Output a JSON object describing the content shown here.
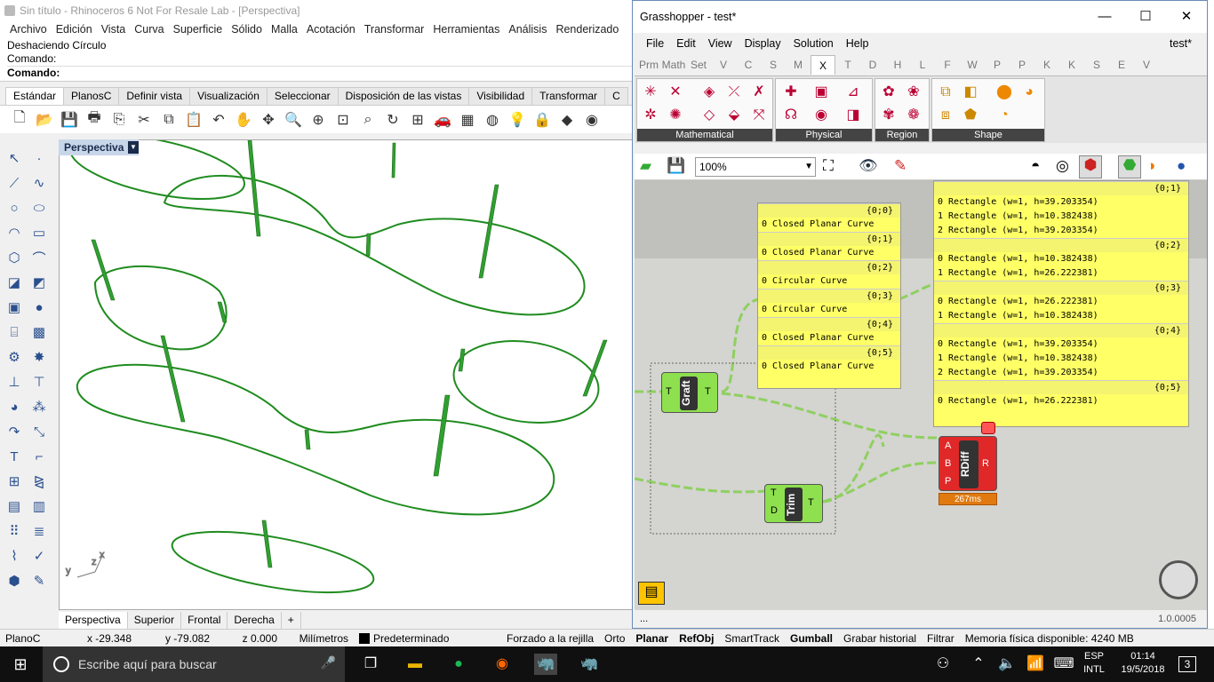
{
  "rhino": {
    "title": "Sin título - Rhinoceros 6 Not For Resale Lab - [Perspectiva]",
    "menu": [
      "Archivo",
      "Edición",
      "Vista",
      "Curva",
      "Superficie",
      "Sólido",
      "Malla",
      "Acotación",
      "Transformar",
      "Herramientas",
      "Análisis",
      "Renderizado"
    ],
    "history": [
      "Deshaciendo Círculo",
      "Comando:"
    ],
    "prompt": "Comando:",
    "tabs": [
      "Estándar",
      "PlanosC",
      "Definir vista",
      "Visualización",
      "Seleccionar",
      "Disposición de las vistas",
      "Visibilidad",
      "Transformar",
      "C"
    ],
    "viewport_label": "Perspectiva",
    "axis_labels": {
      "y": "y",
      "z": "z",
      "x": "x"
    },
    "view_tabs": [
      "Perspectiva",
      "Superior",
      "Frontal",
      "Derecha",
      "+"
    ]
  },
  "status": {
    "cplane": "PlanoC",
    "x": "x -29.348",
    "y": "y -79.082",
    "z": "z 0.000",
    "units": "Milímetros",
    "layer": "Predeterminado",
    "snap": "Forzado a la rejilla",
    "ortho": "Orto",
    "planar": "Planar",
    "osnap": "RefObj",
    "smarttrack": "SmartTrack",
    "gumball": "Gumball",
    "history": "Grabar historial",
    "filter": "Filtrar",
    "memory": "Memoria física disponible: 4240 MB"
  },
  "gh": {
    "title": "Grasshopper - test*",
    "menu": [
      "File",
      "Edit",
      "View",
      "Display",
      "Solution",
      "Help"
    ],
    "doc": "test*",
    "tabs": [
      "Prm",
      "Math",
      "Set",
      "V",
      "C",
      "S",
      "M",
      "X",
      "T",
      "D",
      "H",
      "L",
      "F",
      "W",
      "P",
      "P",
      "K",
      "K",
      "S",
      "E",
      "V"
    ],
    "active_tab": "X",
    "groups": [
      "Mathematical",
      "Physical",
      "Region",
      "Shape"
    ],
    "zoom": "100%",
    "panel1": {
      "rows": [
        [
          "{0;0}",
          "0 Closed Planar Curve"
        ],
        [
          "{0;1}",
          "0 Closed Planar Curve"
        ],
        [
          "{0;2}",
          "0 Circular Curve"
        ],
        [
          "{0;3}",
          "0 Circular Curve"
        ],
        [
          "{0;4}",
          "0 Closed Planar Curve"
        ],
        [
          "{0;5}",
          "0 Closed Planar Curve"
        ]
      ]
    },
    "panel2": {
      "top": "{0;1}",
      "rows1": [
        "0 Rectangle (w=1, h=39.203354)",
        "1 Rectangle (w=1, h=10.382438)",
        "2 Rectangle (w=1, h=39.203354)"
      ],
      "h2": "{0;2}",
      "rows2": [
        "0 Rectangle (w=1, h=10.382438)",
        "1 Rectangle (w=1, h=26.222381)"
      ],
      "h3": "{0;3}",
      "rows3": [
        "0 Rectangle (w=1, h=26.222381)",
        "1 Rectangle (w=1, h=10.382438)"
      ],
      "h4": "{0;4}",
      "rows4": [
        "0 Rectangle (w=1, h=39.203354)",
        "1 Rectangle (w=1, h=10.382438)",
        "2 Rectangle (w=1, h=39.203354)"
      ],
      "h5": "{0;5}",
      "rows5": [
        "0 Rectangle (w=1, h=26.222381)"
      ]
    },
    "graft": {
      "name": "Graft",
      "in": "T",
      "out": "T"
    },
    "trim": {
      "name": "Trim",
      "in1": "T",
      "in2": "D",
      "out": "T"
    },
    "rdiff": {
      "name": "RDiff",
      "inA": "A",
      "inB": "B",
      "inP": "P",
      "out": "R",
      "time": "267ms"
    },
    "footer": "...",
    "version": "1.0.0005"
  },
  "taskbar": {
    "search": "Escribe aquí para buscar",
    "lang1": "ESP",
    "lang2": "INTL",
    "time": "01:14",
    "date": "19/5/2018",
    "notif": "3"
  }
}
